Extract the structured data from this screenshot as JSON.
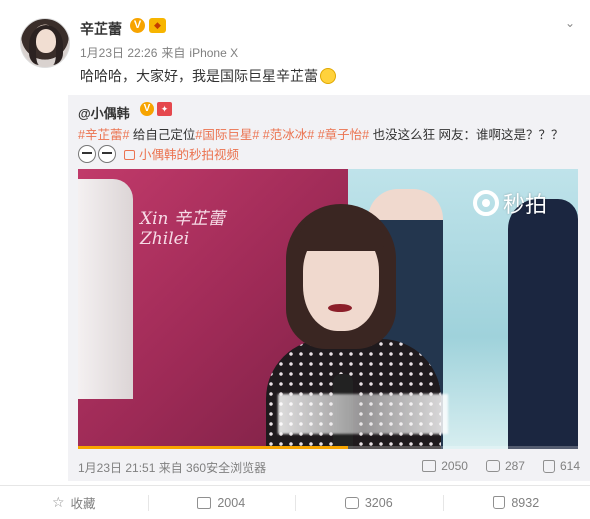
{
  "post": {
    "username": "辛芷蕾",
    "date": "1月23日 22:26",
    "source_prefix": "来自",
    "source": "iPhone X",
    "text": "哈哈哈，大家好，我是国际巨星辛芷蕾"
  },
  "repost": {
    "username": "@小偶韩",
    "tags": [
      "#辛芷蕾#",
      "#国际巨星#",
      "#范冰冰#",
      "#章子怡#"
    ],
    "text_1": "给自己定位",
    "text_2": "也没这么狂 网友：谁啊这是？？？",
    "video_link": "小偶韩的秒拍视频",
    "video_watermark": "秒拍",
    "video_logo_line1": "Xin 辛芷蕾",
    "video_logo_line2": "Zhilei",
    "video_progress": 0.54,
    "time": "1月23日 21:51 来自 360安全浏览器",
    "reposts": "2050",
    "comments": "287",
    "likes": "614"
  },
  "actions": {
    "favorite": "收藏",
    "reposts": "2004",
    "comments": "3206",
    "likes": "8932"
  },
  "colors": {
    "accent": "#eb7350",
    "badge": "#f7a400"
  },
  "icons": [
    "chevron-down-icon",
    "verified-badge-icon",
    "vip-badge-icon",
    "laughing-emoji-icon",
    "video-icon",
    "repost-icon",
    "comment-icon",
    "like-icon",
    "star-icon"
  ]
}
